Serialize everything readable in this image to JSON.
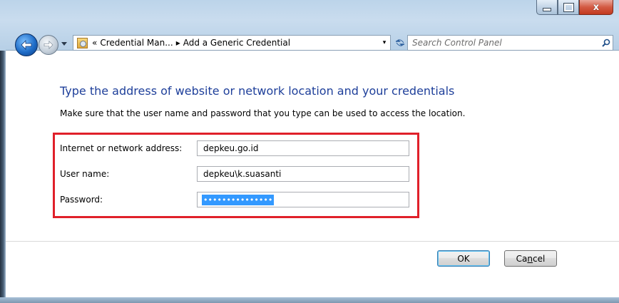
{
  "window": {
    "caption_buttons": [
      "minimize",
      "maximize",
      "close"
    ],
    "close_glyph": "x"
  },
  "nav": {
    "back_icon": "back-arrow-icon",
    "forward_icon": "forward-arrow-icon"
  },
  "address_bar": {
    "prefix": "«",
    "crumb1": "Credential Man...",
    "separator": "▸",
    "crumb2": "Add a Generic Credential",
    "dropdown": "▾"
  },
  "search": {
    "placeholder": "Search Control Panel"
  },
  "content": {
    "heading": "Type the address of website or network location and your credentials",
    "instructions": "Make sure that the user name and password that you type can be used to access the location.",
    "fields": [
      {
        "label": "Internet or network address:",
        "value": "depkeu.go.id"
      },
      {
        "label": "User name:",
        "value": "depkeu\\k.suasanti"
      },
      {
        "label": "Password:",
        "value": "•••••••••••••••"
      }
    ]
  },
  "buttons": {
    "ok": "OK",
    "cancel_pre": "Ca",
    "cancel_mnemonic": "n",
    "cancel_post": "cel"
  },
  "colors": {
    "heading": "#1e3f9a",
    "highlight_border": "#e0202a",
    "selection": "#3399ff"
  }
}
